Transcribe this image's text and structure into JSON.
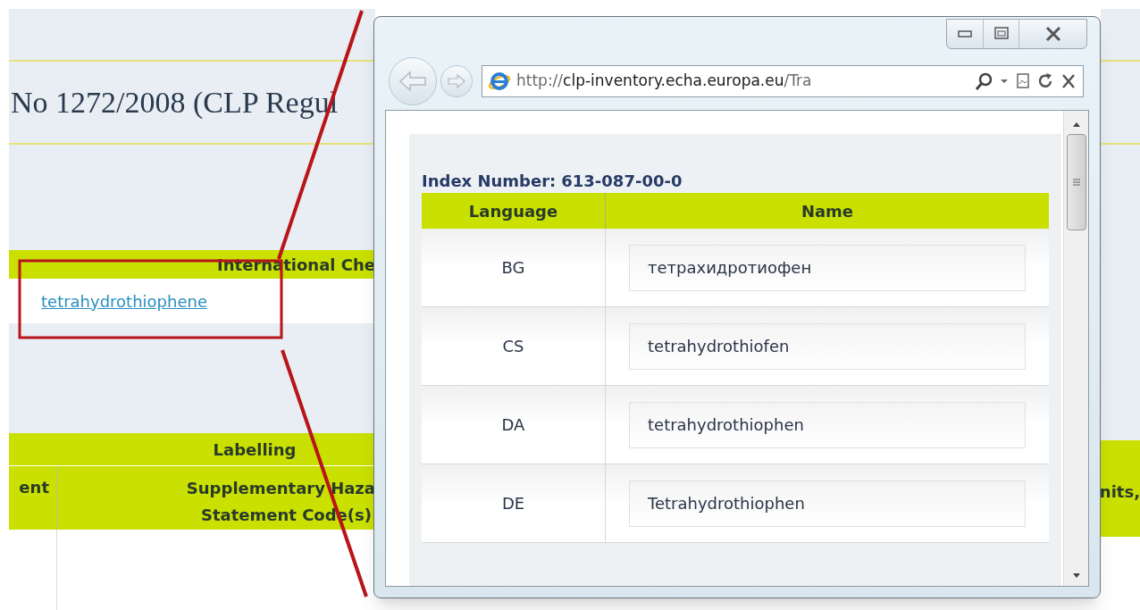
{
  "page": {
    "title": "No 1272/2008 (CLP Regul",
    "identity_header": "International Che",
    "substance_link": "tetrahydrothiophene",
    "labelling_header": "Labelling",
    "column_1_header": "ent",
    "supplementary_header": [
      "Supplementary Haza",
      "Statement Code(s)"
    ],
    "right_header": "nits,"
  },
  "popup": {
    "address": {
      "scheme": "http://",
      "domain": "clp-inventory.echa.europa.eu",
      "path": "/Tra"
    },
    "index_label": "Index Number:",
    "index_value": "613-087-00-0",
    "columns": [
      "Language",
      "Name"
    ],
    "rows": [
      {
        "language": "BG",
        "name": "тетрахидротиофен"
      },
      {
        "language": "CS",
        "name": "tetrahydrothiofen"
      },
      {
        "language": "DA",
        "name": "tetrahydrothiophen"
      },
      {
        "language": "DE",
        "name": "Tetrahydrothiophen"
      }
    ]
  }
}
